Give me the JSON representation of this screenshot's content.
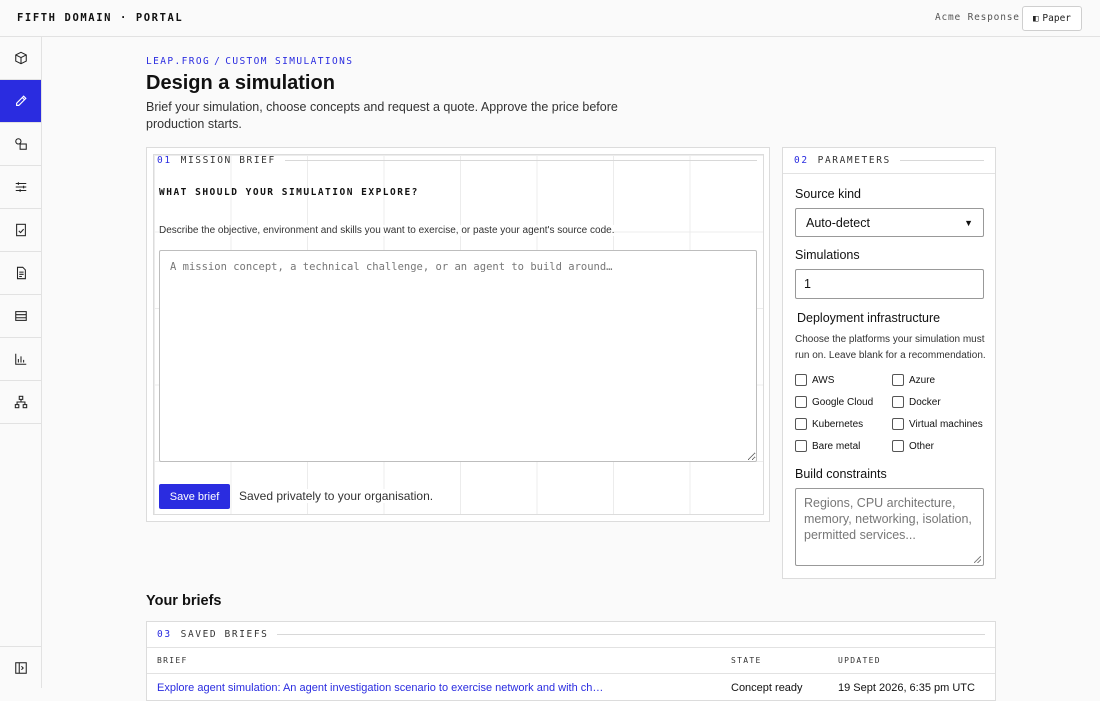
{
  "app": {
    "brand": "FIFTH DOMAIN · PORTAL",
    "org": "Acme Response",
    "theme_label": "Paper"
  },
  "breadcrumb": {
    "parent": "LEAP.FROG",
    "separator": "/",
    "current": "CUSTOM SIMULATIONS"
  },
  "page": {
    "title": "Design a simulation",
    "subtitle": "Brief your simulation, choose concepts and request a quote. Approve the price before production starts."
  },
  "mission_brief": {
    "number": "01",
    "heading": "MISSION BRIEF",
    "question": "WHAT SHOULD YOUR SIMULATION EXPLORE?",
    "description": "Describe the objective, environment and skills you want to exercise, or paste your agent's source code.",
    "placeholder": "A mission concept, a technical challenge, or an agent to build around…",
    "save_label": "Save brief",
    "save_note": "Saved privately to your organisation."
  },
  "parameters": {
    "number": "02",
    "heading": "PARAMETERS",
    "source_kind_label": "Source kind",
    "source_kind_value": "Auto-detect",
    "simulations_label": "Simulations",
    "simulations_value": "1",
    "infra_label": "Deployment infrastructure",
    "infra_help": "Choose the platforms your simulation must run on. Leave blank for a recommendation.",
    "platforms": [
      "AWS",
      "Azure",
      "Google Cloud",
      "Docker",
      "Kubernetes",
      "Virtual machines",
      "Bare metal",
      "Other"
    ],
    "constraints_label": "Build constraints",
    "constraints_placeholder": "Regions, CPU architecture, memory, networking, isolation, permitted services..."
  },
  "briefs": {
    "title": "Your briefs",
    "number": "03",
    "heading": "SAVED BRIEFS",
    "columns": {
      "brief": "BRIEF",
      "state": "STATE",
      "updated": "UPDATED"
    },
    "rows": [
      {
        "brief": "Explore agent simulation: An agent investigation scenario to exercise network and with ch…",
        "state": "Concept ready",
        "updated": "19 Sept 2026, 6:35 pm UTC"
      }
    ]
  }
}
